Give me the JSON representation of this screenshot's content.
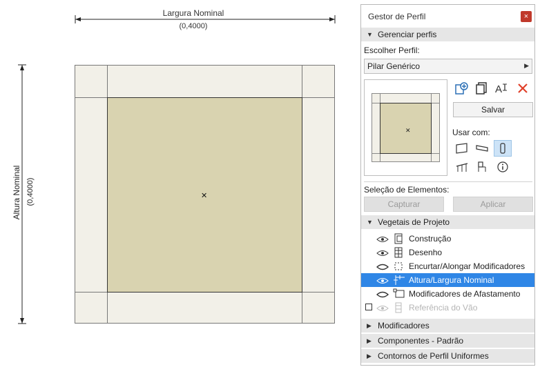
{
  "canvas": {
    "dim_width_title": "Largura Nominal",
    "dim_width_value": "(0,4000)",
    "dim_height_title": "Altura Nominal",
    "dim_height_value": "(0,4000)"
  },
  "panel": {
    "title": "Gestor de Perfil",
    "close_glyph": "×",
    "section_manage": "Gerenciar perfis",
    "choose_label": "Escolher Perfil:",
    "profile_value": "Pilar Genérico",
    "save_label": "Salvar",
    "use_with_label": "Usar com:",
    "selection_label": "Seleção de Elementos:",
    "capture_label": "Capturar",
    "apply_label": "Aplicar",
    "section_vegetais": "Vegetais de Projeto",
    "section_modifiers": "Modificadores",
    "section_components": "Componentes - Padrão",
    "section_contours": "Contornos de Perfil Uniformes",
    "layers": [
      {
        "label": "Construção",
        "icon": "construction-icon"
      },
      {
        "label": "Desenho",
        "icon": "drawing-icon"
      },
      {
        "label": "Encurtar/Alongar Modificadores",
        "icon": "stretch-icon"
      },
      {
        "label": "Altura/Largura Nominal",
        "icon": "nominal-size-icon",
        "selected": true
      },
      {
        "label": "Modificadores de Afastamento",
        "icon": "offset-modifier-icon"
      },
      {
        "label": "Referência do Vão",
        "icon": "opening-reference-icon",
        "faded": true
      }
    ]
  },
  "colors": {
    "core_fill": "#d9d3b0",
    "frame_fill": "#f2f0e8",
    "selection": "#2f86e6",
    "close": "#c0392b",
    "delete_icon": "#e0402a"
  }
}
